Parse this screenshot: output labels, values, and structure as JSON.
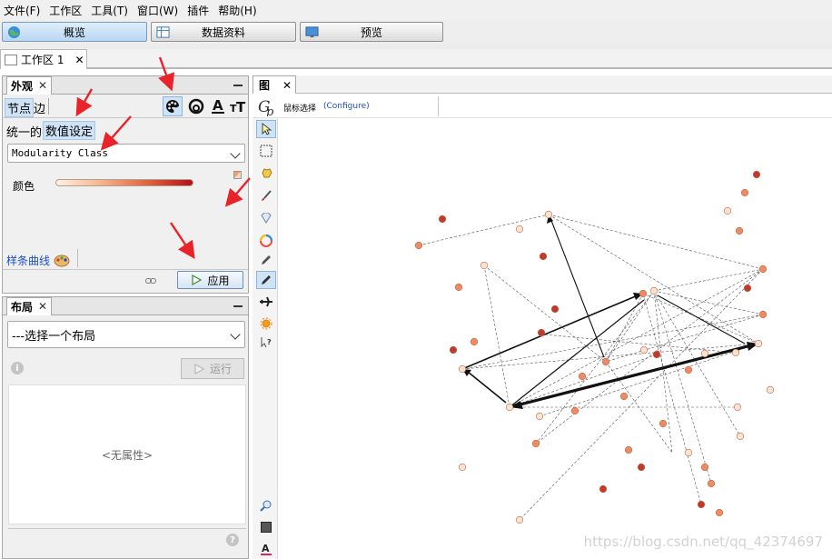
{
  "menu": [
    "文件(F)",
    "工作区",
    "工具(T)",
    "窗口(W)",
    "插件",
    "帮助(H)"
  ],
  "toolbar": {
    "overview": "概览",
    "data_lab": "数据资料",
    "preview": "预览"
  },
  "workspace_tab": {
    "label": "工作区 1",
    "close": "✕"
  },
  "appearance": {
    "title": "外观",
    "close": "✕",
    "tabs": {
      "nodes": "节点",
      "edges": "边"
    },
    "mode_unique": "统一的",
    "mode_partition": "数值设定",
    "attribute_selected": "Modularity Class",
    "color_label": "颜色",
    "spline_link": "样条曲线",
    "apply": "应用"
  },
  "layout": {
    "title": "布局",
    "close": "✕",
    "select_placeholder": "---选择一个布局",
    "run": "运行",
    "no_properties": "<无属性>"
  },
  "graph": {
    "tab_label": "图",
    "close": "✕",
    "mouse_select": "鼠标选择",
    "configure": "(Configure)"
  },
  "watermark": "https://blog.csdn.net/qq_42374697",
  "colors": {
    "node_light": "#fbe3cf",
    "node_mid": "#ef8a62",
    "node_dark": "#c0392b",
    "arrow_red": "#e8242a",
    "link_blue": "#1a4fc6"
  }
}
